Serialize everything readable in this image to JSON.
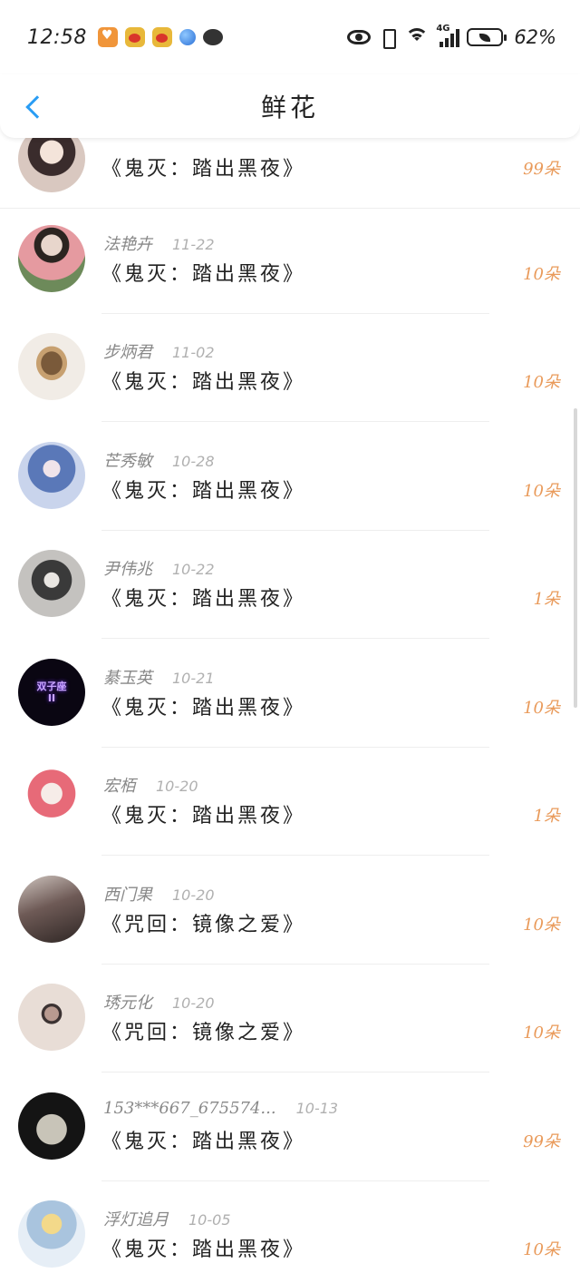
{
  "status_bar": {
    "time": "12:58",
    "battery": "62%",
    "network": "4G",
    "notification_icons": [
      "heart-app-icon",
      "weibo-icon",
      "weibo-icon",
      "browser-globe-icon",
      "chat-bubble-icon"
    ]
  },
  "header": {
    "title": "鲜花"
  },
  "colors": {
    "accent": "#2a9df4",
    "count": "#e99a5a",
    "meta": "#888888",
    "date": "#b0b0b0"
  },
  "items": [
    {
      "name": "",
      "date": "",
      "title": "《鬼灭：踏出黑夜》",
      "count": "99朵",
      "avatar": "anime-girl-avatar"
    },
    {
      "name": "法艳卉",
      "date": "11-22",
      "title": "《鬼灭：踏出黑夜》",
      "count": "10朵",
      "avatar": "girl-photo-avatar"
    },
    {
      "name": "步炳君",
      "date": "11-02",
      "title": "《鬼灭：踏出黑夜》",
      "count": "10朵",
      "avatar": "cat-avatar"
    },
    {
      "name": "芒秀敏",
      "date": "10-28",
      "title": "《鬼灭：踏出黑夜》",
      "count": "10朵",
      "avatar": "blue-hair-avatar"
    },
    {
      "name": "尹伟兆",
      "date": "10-22",
      "title": "《鬼灭：踏出黑夜》",
      "count": "1朵",
      "avatar": "sketch-avatar"
    },
    {
      "name": "綦玉英",
      "date": "10-21",
      "title": "《鬼灭：踏出黑夜》",
      "count": "10朵",
      "avatar": "gemini-avatar",
      "avatar_text": "双子座\nII"
    },
    {
      "name": "宏栢",
      "date": "10-20",
      "title": "《鬼灭：踏出黑夜》",
      "count": "1朵",
      "avatar": "pink-jacket-avatar"
    },
    {
      "name": "西门果",
      "date": "10-20",
      "title": "《咒回：镜像之爱》",
      "count": "10朵",
      "avatar": "couple-avatar"
    },
    {
      "name": "琇元化",
      "date": "10-20",
      "title": "《咒回：镜像之爱》",
      "count": "10朵",
      "avatar": "clothes-avatar"
    },
    {
      "name": "153***667_675574...",
      "date": "10-13",
      "title": "《鬼灭：踏出黑夜》",
      "count": "99朵",
      "avatar": "moon-avatar"
    },
    {
      "name": "浮灯追月",
      "date": "10-05",
      "title": "《鬼灭：踏出黑夜》",
      "count": "10朵",
      "avatar": "blonde-anime-avatar"
    }
  ]
}
